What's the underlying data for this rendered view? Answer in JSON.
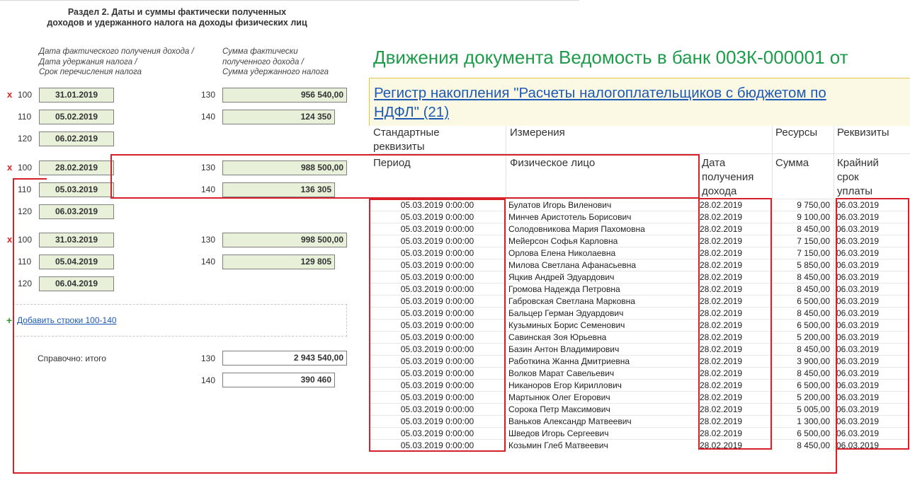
{
  "form": {
    "section_title_line1": "Раздел 2.  Даты и суммы фактически полученных",
    "section_title_line2": "доходов и удержанного налога на доходы физических лиц",
    "col1_caption": [
      "Дата фактического получения дохода /",
      "Дата удержания налога /",
      "Срок перечисления налога"
    ],
    "col2_caption": [
      "Сумма фактически",
      "полученного дохода /",
      "Сумма удержанного налога"
    ],
    "delete_mark": "x",
    "blocks": [
      {
        "code100": "100",
        "date100": "31.01.2019",
        "code130": "130",
        "sum130": "956 540,00",
        "code110": "110",
        "date110": "05.02.2019",
        "code140": "140",
        "sum140": "124 350",
        "code120": "120",
        "date120": "06.02.2019"
      },
      {
        "code100": "100",
        "date100": "28.02.2019",
        "code130": "130",
        "sum130": "988 500,00",
        "code110": "110",
        "date110": "05.03.2019",
        "code140": "140",
        "sum140": "136 305",
        "code120": "120",
        "date120": "06.03.2019"
      },
      {
        "code100": "100",
        "date100": "31.03.2019",
        "code130": "130",
        "sum130": "998 500,00",
        "code110": "110",
        "date110": "05.04.2019",
        "code140": "140",
        "sum140": "129 805",
        "code120": "120",
        "date120": "06.04.2019"
      }
    ],
    "add_plus": "+",
    "add_link": "Добавить строки 100-140",
    "ref_label": "Справочно: итого",
    "total_code130": "130",
    "total_sum130": "2 943 540,00",
    "total_code140": "140",
    "total_sum140": "390 460"
  },
  "register": {
    "doc_title": "Движения документа Ведомость в банк 003К-000001 от",
    "register_link_line1": "Регистр накопления \"Расчеты налогоплательщиков с бюджетом по",
    "register_link_line2": "НДФЛ\" (21)",
    "group_headers": {
      "standard": [
        "Стандартные",
        "реквизиты"
      ],
      "dims": "Измерения",
      "resources": "Ресурсы",
      "props": "Реквизиты"
    },
    "columns": {
      "period": "Период",
      "person": "Физическое лицо",
      "income_date": [
        "Дата",
        "получения",
        "дохода"
      ],
      "sum": "Сумма",
      "due": [
        "Крайний",
        "срок",
        "уплаты"
      ]
    },
    "rows": [
      {
        "period": "05.03.2019 0:00:00",
        "person": "Булатов Игорь Виленович",
        "date": "28.02.2019",
        "sum": "9 750,00",
        "due": "06.03.2019"
      },
      {
        "period": "05.03.2019 0:00:00",
        "person": "Минчев Аристотель Борисович",
        "date": "28.02.2019",
        "sum": "9 100,00",
        "due": "06.03.2019"
      },
      {
        "period": "05.03.2019 0:00:00",
        "person": "Солодовникова Мария Пахомовна",
        "date": "28.02.2019",
        "sum": "8 450,00",
        "due": "06.03.2019"
      },
      {
        "period": "05.03.2019 0:00:00",
        "person": "Мейерсон Софья Карловна",
        "date": "28.02.2019",
        "sum": "7 150,00",
        "due": "06.03.2019"
      },
      {
        "period": "05.03.2019 0:00:00",
        "person": "Орлова Елена Николаевна",
        "date": "28.02.2019",
        "sum": "7 150,00",
        "due": "06.03.2019"
      },
      {
        "period": "05.03.2019 0:00:00",
        "person": "Милова Светлана Афанасьевна",
        "date": "28.02.2019",
        "sum": "5 850,00",
        "due": "06.03.2019"
      },
      {
        "period": "05.03.2019 0:00:00",
        "person": "Яцкив Андрей Эдуардович",
        "date": "28.02.2019",
        "sum": "8 450,00",
        "due": "06.03.2019"
      },
      {
        "period": "05.03.2019 0:00:00",
        "person": "Громова Надежда Петровна",
        "date": "28.02.2019",
        "sum": "8 450,00",
        "due": "06.03.2019"
      },
      {
        "period": "05.03.2019 0:00:00",
        "person": "Габровская Светлана Марковна",
        "date": "28.02.2019",
        "sum": "6 500,00",
        "due": "06.03.2019"
      },
      {
        "period": "05.03.2019 0:00:00",
        "person": "Бальцер Герман Эдуардович",
        "date": "28.02.2019",
        "sum": "8 450,00",
        "due": "06.03.2019"
      },
      {
        "period": "05.03.2019 0:00:00",
        "person": "Кузьминых Борис Семенович",
        "date": "28.02.2019",
        "sum": "6 500,00",
        "due": "06.03.2019"
      },
      {
        "period": "05.03.2019 0:00:00",
        "person": "Савинская Зоя Юрьевна",
        "date": "28.02.2019",
        "sum": "5 200,00",
        "due": "06.03.2019"
      },
      {
        "period": "05.03.2019 0:00:00",
        "person": "Базин Антон Владимирович",
        "date": "28.02.2019",
        "sum": "8 450,00",
        "due": "06.03.2019"
      },
      {
        "period": "05.03.2019 0:00:00",
        "person": "Работкина Жанна Дмитриевна",
        "date": "28.02.2019",
        "sum": "3 900,00",
        "due": "06.03.2019"
      },
      {
        "period": "05.03.2019 0:00:00",
        "person": "Волков Марат Савельевич",
        "date": "28.02.2019",
        "sum": "8 450,00",
        "due": "06.03.2019"
      },
      {
        "period": "05.03.2019 0:00:00",
        "person": "Никаноров Егор Кириллович",
        "date": "28.02.2019",
        "sum": "6 500,00",
        "due": "06.03.2019"
      },
      {
        "period": "05.03.2019 0:00:00",
        "person": "Мартынюк Олег Егорович",
        "date": "28.02.2019",
        "sum": "5 200,00",
        "due": "06.03.2019"
      },
      {
        "period": "05.03.2019 0:00:00",
        "person": "Сорока Петр Максимович",
        "date": "28.02.2019",
        "sum": "5 005,00",
        "due": "06.03.2019"
      },
      {
        "period": "05.03.2019 0:00:00",
        "person": "Ваньков Александр Матвеевич",
        "date": "28.02.2019",
        "sum": "1 300,00",
        "due": "06.03.2019"
      },
      {
        "period": "05.03.2019 0:00:00",
        "person": "Шведов Игорь Сергеевич",
        "date": "28.02.2019",
        "sum": "6 500,00",
        "due": "06.03.2019"
      },
      {
        "period": "05.03.2019 0:00:00",
        "person": "Козьмин Глеб Матвеевич",
        "date": "28.02.2019",
        "sum": "8 450,00",
        "due": "06.03.2019"
      }
    ]
  }
}
